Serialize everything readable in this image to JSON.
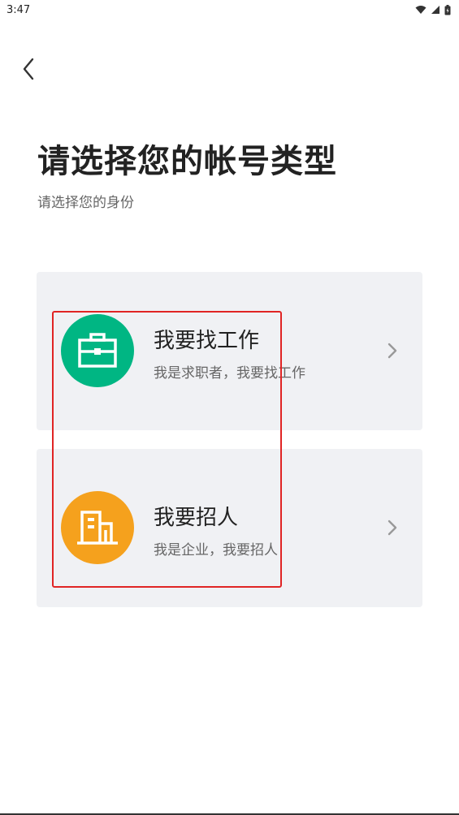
{
  "status_bar": {
    "time": "3:47"
  },
  "header": {
    "title": "请选择您的帐号类型",
    "subtitle": "请选择您的身份"
  },
  "options": [
    {
      "title": "我要找工作",
      "description": "我是求职者，我要找工作",
      "icon": "briefcase-icon",
      "color": "#00b683"
    },
    {
      "title": "我要招人",
      "description": "我是企业，我要招人",
      "icon": "building-icon",
      "color": "#f5a11d"
    }
  ],
  "colors": {
    "card_background": "#f0f1f4",
    "highlight": "#e02424"
  }
}
